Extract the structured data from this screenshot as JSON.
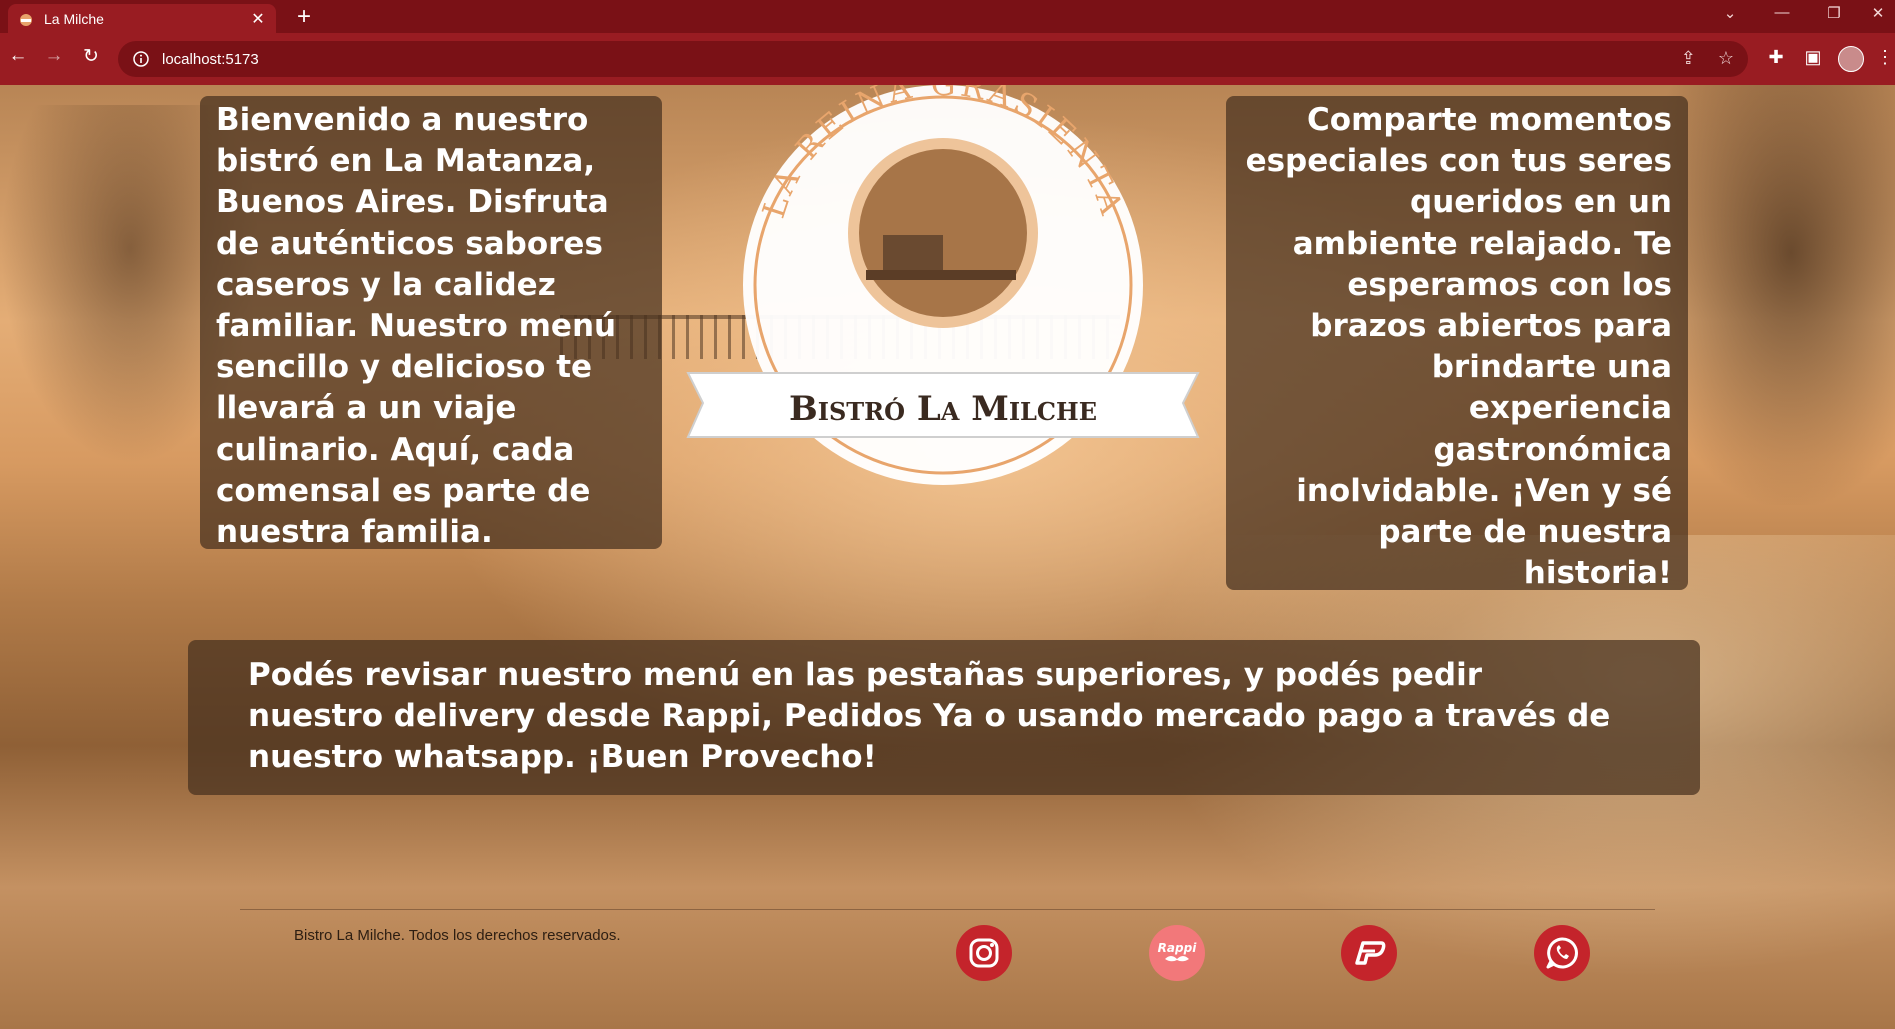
{
  "browser": {
    "tab_title": "La Milche",
    "tab_close": "✕",
    "new_tab": "+",
    "url": "localhost:5173"
  },
  "logo": {
    "arc_text": "LA REINA GRASIENTA",
    "ribbon_text": "Bistró La Milche"
  },
  "intro": {
    "left_text": "Bienvenido a nuestro bistró en La Matanza, Buenos Aires. Disfruta de auténticos sabores caseros y la calidez familiar. Nuestro menú sencillo y delicioso te llevará a un viaje culinario. Aquí, cada comensal es parte de nuestra familia.",
    "right_text": "Comparte momentos especiales con tus seres queridos en un ambiente relajado. Te esperamos con los brazos abiertos para brindarte una experiencia gastronómica inolvidable. ¡Ven y sé parte de nuestra historia!",
    "bottom_text": "Podés revisar nuestro menú en las pestañas superiores, y podés pedir nuestro delivery desde Rappi, Pedidos Ya o usando mercado pago a través de nuestro whatsapp. ¡Buen Provecho!"
  },
  "footer": {
    "copyright": "Bistro La Milche. Todos los derechos reservados.",
    "social": [
      {
        "icon": "instagram-icon",
        "color": "#c4242b"
      },
      {
        "icon": "rappi-icon",
        "label": "Rappi",
        "color": "#f2787a"
      },
      {
        "icon": "pedidosya-icon",
        "color": "#c4242b"
      },
      {
        "icon": "whatsapp-icon",
        "color": "#c4242b"
      }
    ]
  },
  "colors": {
    "chrome_dark": "#7a1116",
    "chrome": "#991c22",
    "panel": "#46301e",
    "accent": "#c4242b"
  }
}
